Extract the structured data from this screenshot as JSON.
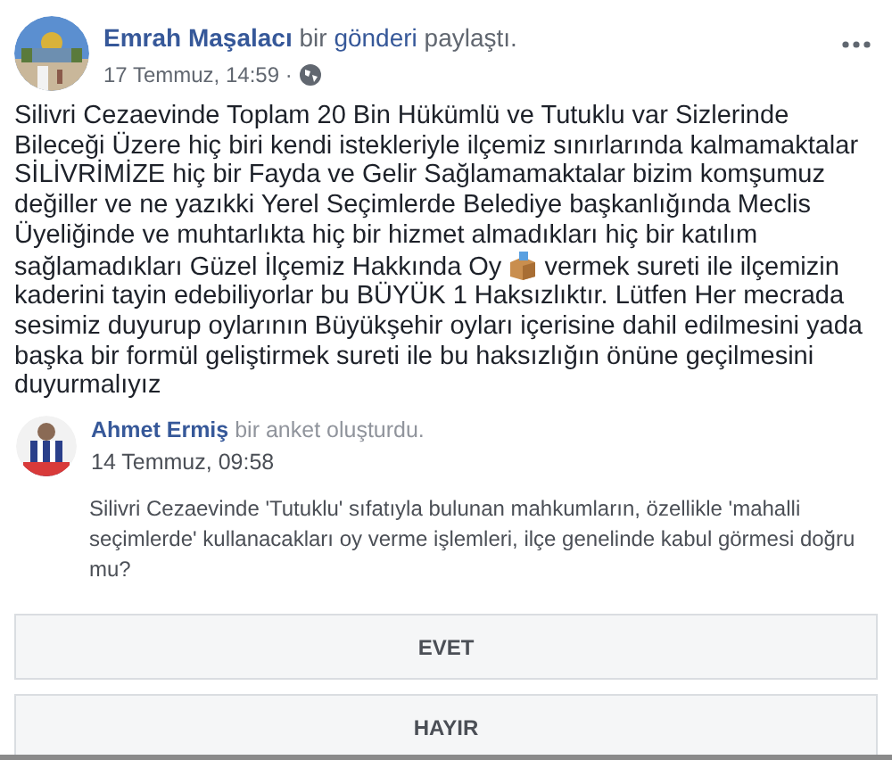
{
  "post": {
    "author": "Emrah Maşalacı",
    "action_before": "bir",
    "action_link": "gönderi",
    "action_after": "paylaştı.",
    "time": "17 Temmuz, 14:59 ·",
    "text_before_icon": "Silivri Cezaevinde Toplam 20 Bin Hükümlü ve Tutuklu var Sizlerinde Bileceği Üzere hiç biri kendi istekleriyle ilçemiz sınırlarında kalmamaktalar SİLİVRİMİZE hiç bir Fayda ve Gelir Sağlamamaktalar bizim komşumuz değiller ve ne yazıkki Yerel Seçimlerde Belediye başkanlığında Meclis Üyeliğinde ve muhtarlıkta hiç bir hizmet almadıkları hiç bir katılım sağlamadıkları Güzel İlçemiz Hakkında Oy",
    "text_after_icon": "vermek sureti ile ilçemizin kaderini tayin edebiliyorlar bu BÜYÜK 1 Haksızlıktır. Lütfen Her mecrada sesimiz duyurup oylarının Büyükşehir oyları içerisine dahil edilmesini yada başka bir formül geliştirmek sureti ile bu haksızlığın önüne geçilmesini duyurmalıyız"
  },
  "shared": {
    "author": "Ahmet Ermiş",
    "action": "bir anket oluşturdu.",
    "time": "14 Temmuz, 09:58",
    "question": "Silivri Cezaevinde 'Tutuklu' sıfatıyla bulunan mahkumların, özellikle 'mahalli seçimlerde' kullanacakları oy verme işlemleri, ilçe genelinde kabul görmesi doğru mu?"
  },
  "poll_options": [
    {
      "label": "EVET"
    },
    {
      "label": "HAYIR"
    }
  ]
}
